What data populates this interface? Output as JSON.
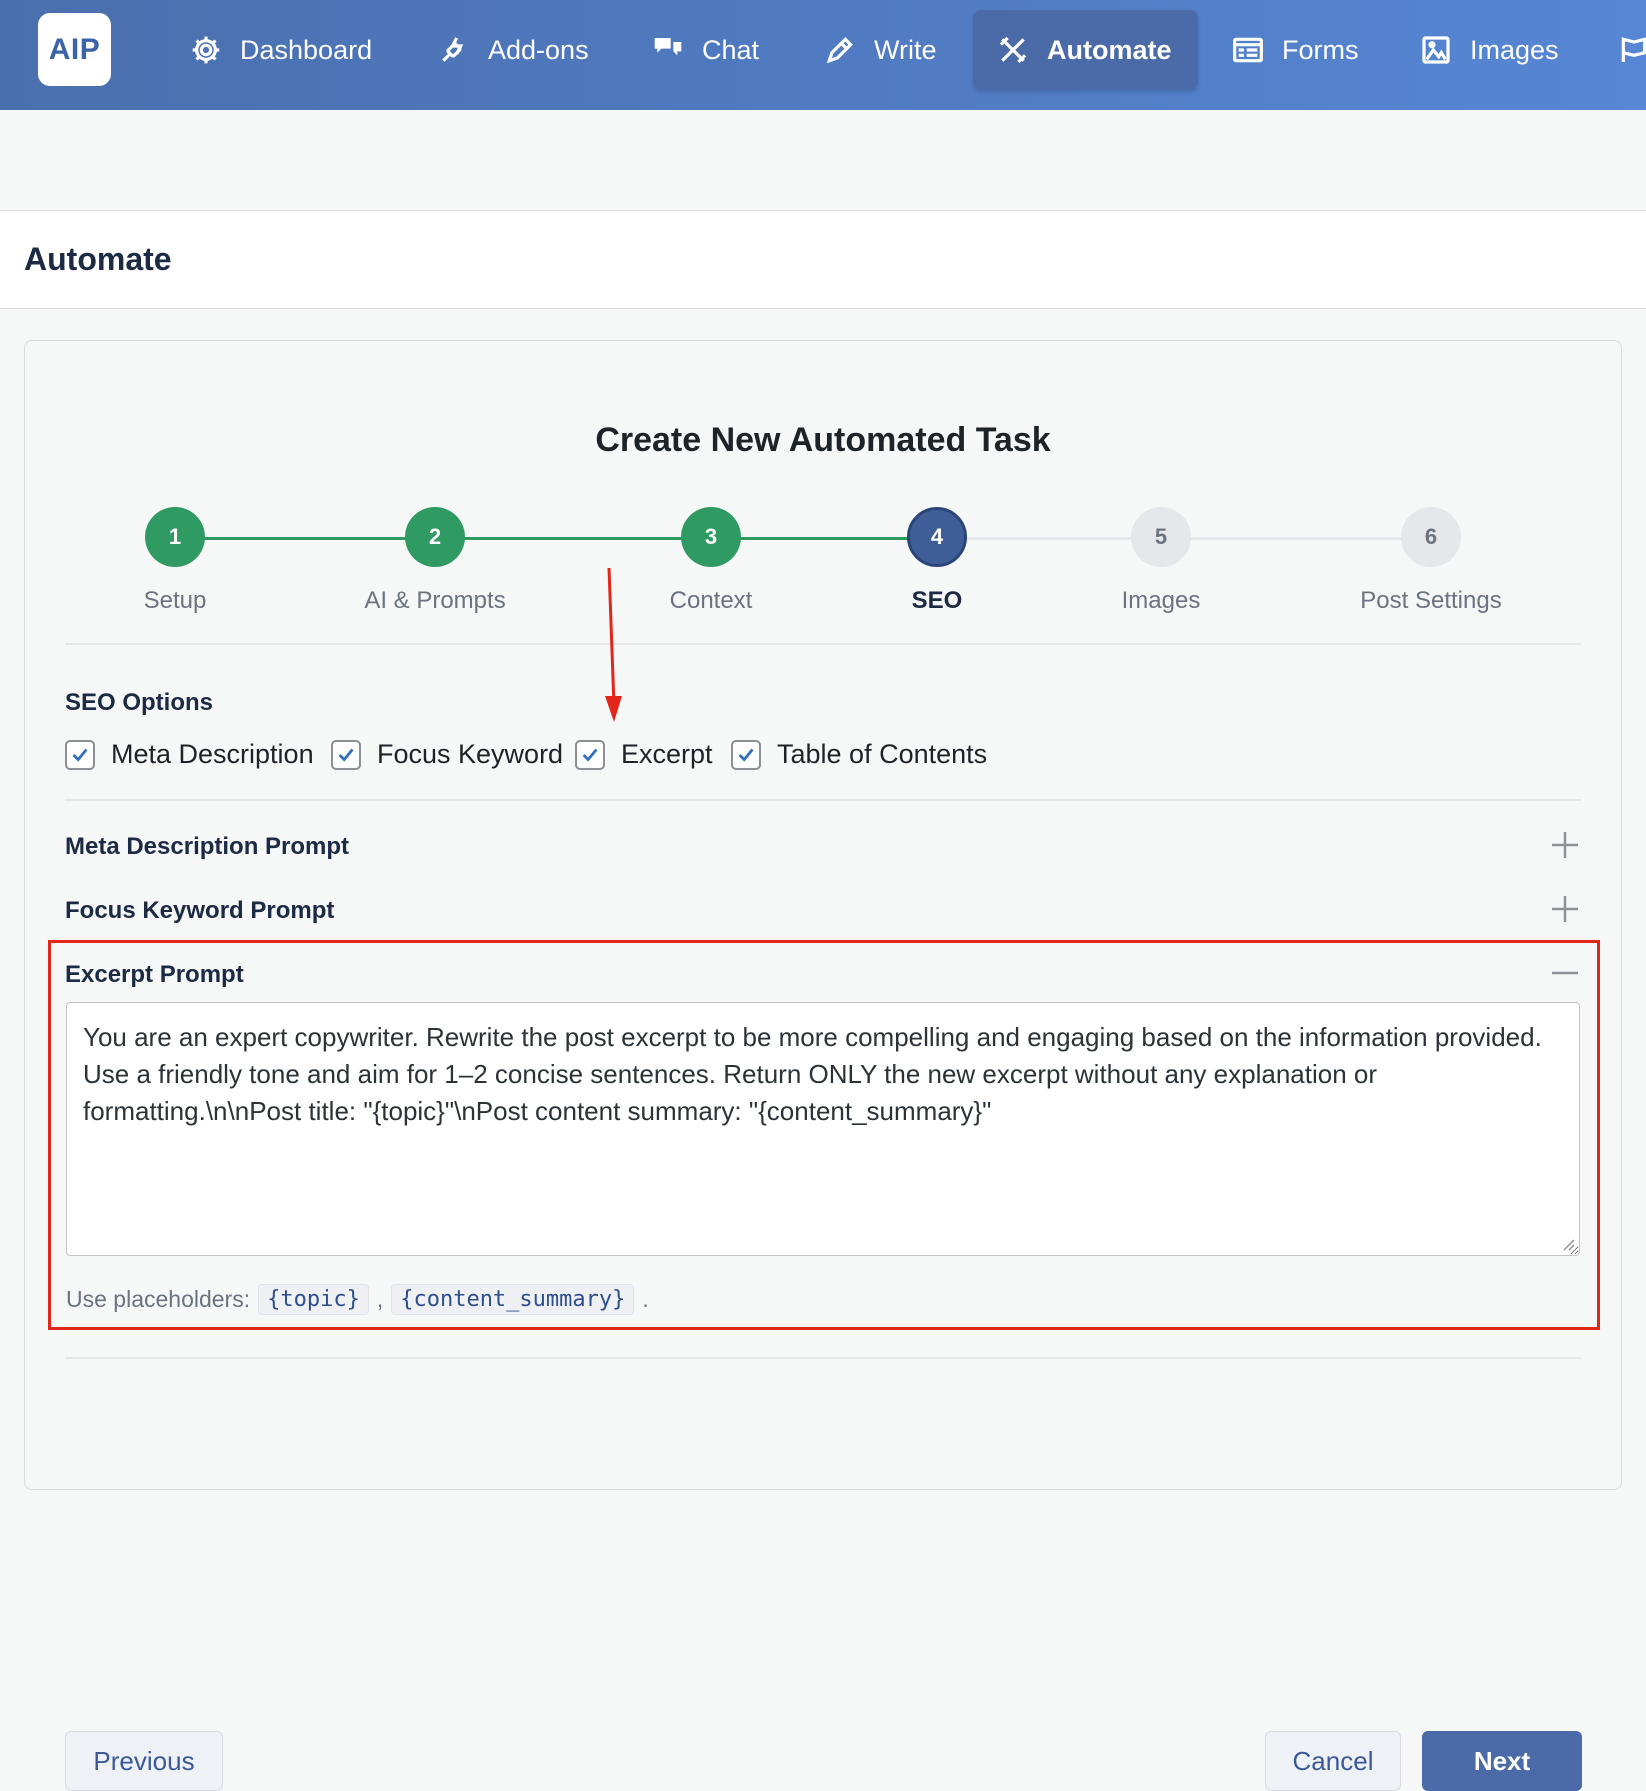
{
  "nav": {
    "logo": "AIP",
    "items": [
      {
        "label": "Dashboard",
        "icon": "gear-icon"
      },
      {
        "label": "Add-ons",
        "icon": "plug-icon"
      },
      {
        "label": "Chat",
        "icon": "chat-icon"
      },
      {
        "label": "Write",
        "icon": "pencil-icon"
      },
      {
        "label": "Automate",
        "icon": "tools-icon",
        "active": true
      },
      {
        "label": "Forms",
        "icon": "form-icon"
      },
      {
        "label": "Images",
        "icon": "image-icon"
      }
    ]
  },
  "page": {
    "title": "Automate"
  },
  "card": {
    "title": "Create New Automated Task"
  },
  "steps": [
    {
      "number": "1",
      "label": "Setup",
      "state": "done"
    },
    {
      "number": "2",
      "label": "AI & Prompts",
      "state": "done"
    },
    {
      "number": "3",
      "label": "Context",
      "state": "done"
    },
    {
      "number": "4",
      "label": "SEO",
      "state": "current"
    },
    {
      "number": "5",
      "label": "Images",
      "state": "todo"
    },
    {
      "number": "6",
      "label": "Post Settings",
      "state": "todo"
    }
  ],
  "seo": {
    "options_label": "SEO Options",
    "options": [
      {
        "label": "Meta Description",
        "checked": true
      },
      {
        "label": "Focus Keyword",
        "checked": true
      },
      {
        "label": "Excerpt",
        "checked": true
      },
      {
        "label": "Table of Contents",
        "checked": true
      }
    ],
    "accordions": [
      {
        "label": "Meta Description Prompt",
        "expanded": false
      },
      {
        "label": "Focus Keyword Prompt",
        "expanded": false
      },
      {
        "label": "Excerpt Prompt",
        "expanded": true
      }
    ],
    "excerpt_prompt": "You are an expert copywriter. Rewrite the post excerpt to be more compelling and engaging based on the information provided. Use a friendly tone and aim for 1–2 concise sentences. Return ONLY the new excerpt without any explanation or formatting.\\n\\nPost title: \"{topic}\"\\nPost content summary: \"{content_summary}\"",
    "hint_prefix": "Use placeholders:",
    "placeholders": [
      "{topic}",
      "{content_summary}"
    ],
    "hint_sep": ",",
    "hint_end": "."
  },
  "buttons": {
    "previous": "Previous",
    "cancel": "Cancel",
    "next": "Next"
  },
  "colors": {
    "accent": "#4a6aa8",
    "done": "#2f9a62",
    "highlight": "#e3261a"
  }
}
